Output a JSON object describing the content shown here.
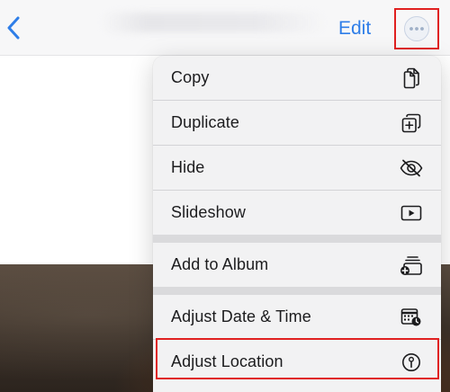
{
  "navbar": {
    "edit_label": "Edit"
  },
  "icons": {
    "back": "chevron-left-icon",
    "more": "ellipsis-circle-icon",
    "copy": "copy-icon",
    "duplicate": "duplicate-icon",
    "hide": "eye-slash-icon",
    "slideshow": "play-rectangle-icon",
    "add_to_album": "add-to-album-icon",
    "adjust_date": "calendar-clock-icon",
    "adjust_location": "location-info-icon"
  },
  "colors": {
    "accent": "#2f7ee8",
    "highlight": "#e02020",
    "menu_background": "#f2f2f3",
    "text": "#1c1c1e"
  },
  "menu": {
    "items": [
      {
        "label": "Copy"
      },
      {
        "label": "Duplicate"
      },
      {
        "label": "Hide"
      },
      {
        "label": "Slideshow"
      },
      {
        "label": "Add to Album"
      },
      {
        "label": "Adjust Date & Time"
      },
      {
        "label": "Adjust Location"
      }
    ]
  }
}
